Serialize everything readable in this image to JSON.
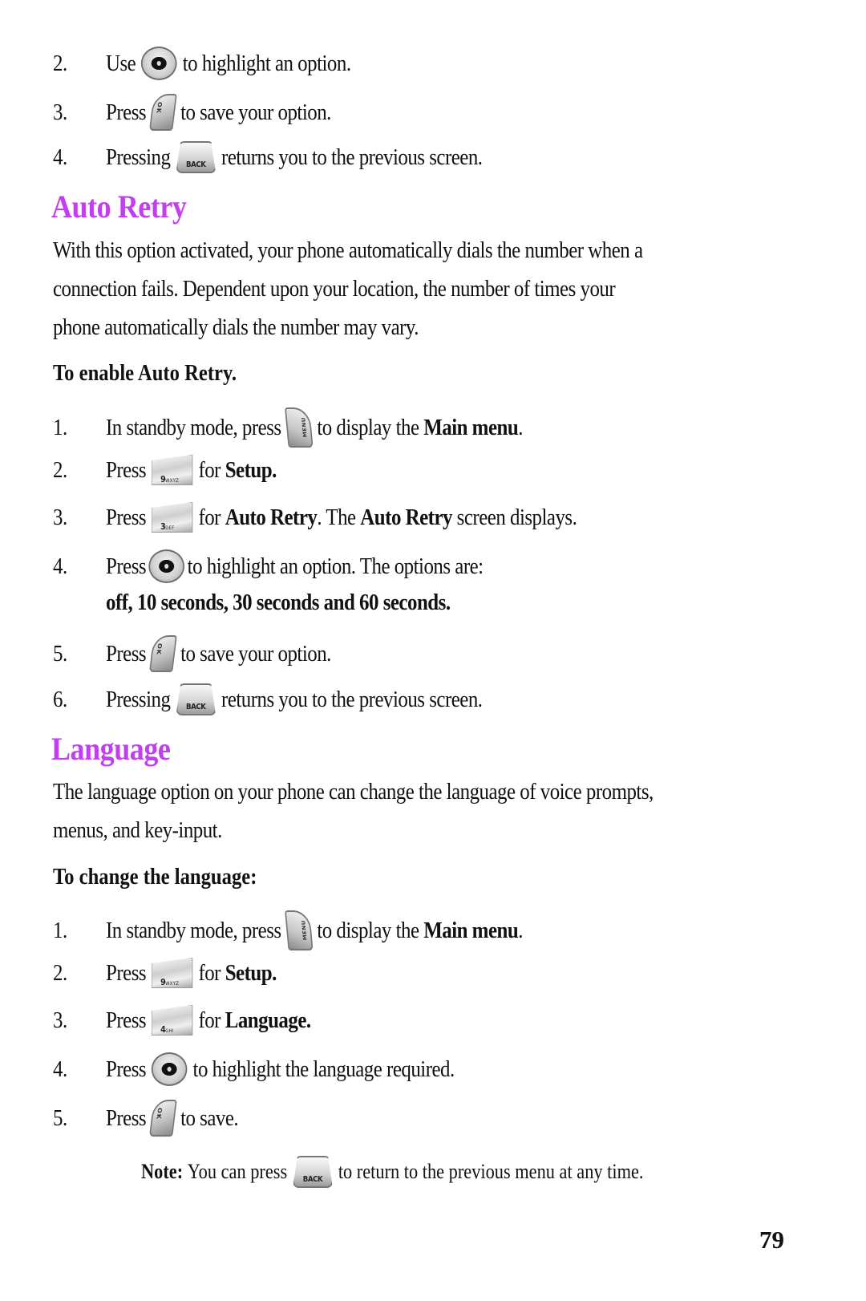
{
  "page_number": "79",
  "colors": {
    "heading": "#c23ff0",
    "text": "#111111"
  },
  "intro_steps": [
    {
      "num": "2.",
      "before": "Use",
      "key": "nav-key",
      "after": "to highlight an option."
    },
    {
      "num": "3.",
      "before": "Press",
      "key": "ok-key",
      "after": "to save your option."
    },
    {
      "num": "4.",
      "before": "Pressing",
      "key": "back-key",
      "after": "returns you to the previous screen."
    }
  ],
  "auto_retry": {
    "heading": "Auto Retry",
    "body_lines": [
      "With this option activated, your phone automatically dials the number when a",
      "connection fails. Dependent upon your location, the number of times your",
      "phone automatically dials the number may vary."
    ],
    "subheading": "To enable Auto Retry.",
    "steps": [
      {
        "num": "1.",
        "before": "In standby mode, press",
        "key": "menu-key",
        "after": "to display the ",
        "bold": "Main menu",
        "tail": "."
      },
      {
        "num": "2.",
        "before": "Press",
        "key": "9-key",
        "after": "for ",
        "bold": "Setup.",
        "tail": ""
      },
      {
        "num": "3.",
        "before": "Press",
        "key": "3-key",
        "after": "for ",
        "bold": "Auto Retry",
        "tail": ". The ",
        "bold2": "Auto Retry",
        "tail2": " screen displays."
      },
      {
        "num": "4.",
        "before": "Press",
        "key": "nav-key",
        "after": "to highlight an option. The options are:"
      },
      {
        "num": "5.",
        "before": "Press",
        "key": "ok-key",
        "after": "to save your option."
      },
      {
        "num": "6.",
        "before": "Pressing",
        "key": "back-key",
        "after": "returns you to the previous screen."
      }
    ],
    "options_line": "off, 10 seconds, 30 seconds and 60 seconds."
  },
  "language": {
    "heading": "Language",
    "body_lines": [
      "The language option on your phone can change the language of voice prompts,",
      "menus, and key-input."
    ],
    "subheading": "To change the language:",
    "steps": [
      {
        "num": "1.",
        "before": "In standby mode, press",
        "key": "menu-key",
        "after": "to display the ",
        "bold": "Main menu",
        "tail": "."
      },
      {
        "num": "2.",
        "before": "Press",
        "key": "9-key",
        "after": "for ",
        "bold": "Setup.",
        "tail": ""
      },
      {
        "num": "3.",
        "before": "Press",
        "key": "4-key",
        "after": "for ",
        "bold": "Language.",
        "tail": ""
      },
      {
        "num": "4.",
        "before": "Press",
        "key": "nav-key",
        "after": "to highlight the language required."
      },
      {
        "num": "5.",
        "before": "Press",
        "key": "ok-key",
        "after": "to save."
      }
    ]
  },
  "note": {
    "label": "Note:",
    "before": "You can press",
    "key": "back-key",
    "after": "to return to the previous menu at any time."
  },
  "key_labels": {
    "ok": "OK",
    "menu": "MENU",
    "back": "BACK",
    "nine_digit": "9",
    "nine_letters": "WXYZ",
    "three_digit": "3",
    "three_letters": "DEF",
    "four_digit": "4",
    "four_letters": "GHI"
  }
}
